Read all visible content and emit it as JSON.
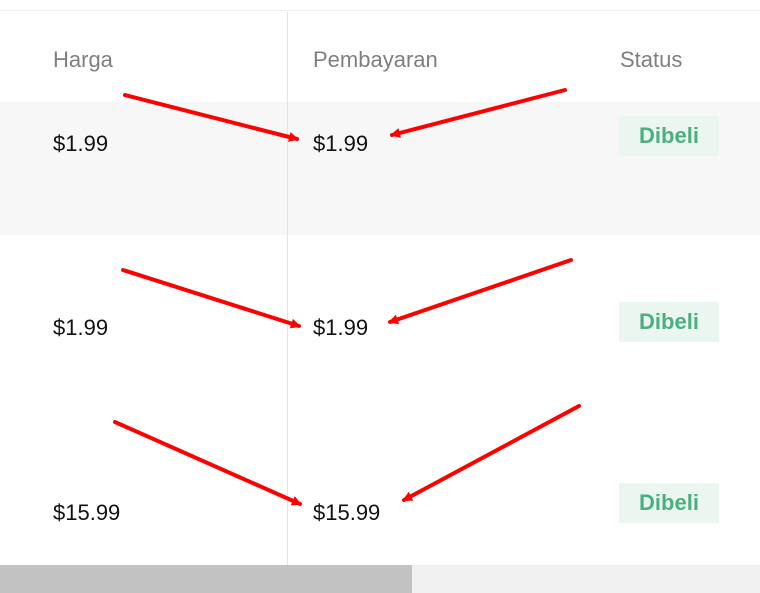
{
  "table": {
    "headers": {
      "harga": "Harga",
      "pembayaran": "Pembayaran",
      "status": "Status"
    },
    "rows": [
      {
        "harga": "$1.99",
        "pembayaran": "$1.99",
        "status": "Dibeli"
      },
      {
        "harga": "$1.99",
        "pembayaran": "$1.99",
        "status": "Dibeli"
      },
      {
        "harga": "$15.99",
        "pembayaran": "$15.99",
        "status": "Dibeli"
      }
    ]
  },
  "colors": {
    "annotation_arrow": "#ff0000",
    "status_badge_text": "#4caf7f",
    "status_badge_bg": "#eaf6ef"
  }
}
